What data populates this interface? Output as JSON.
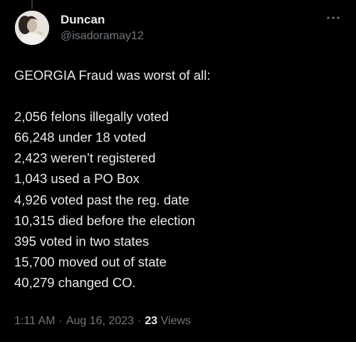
{
  "user": {
    "display_name": "Duncan",
    "handle": "@isadoramay12"
  },
  "tweet": {
    "text": "GEORGIA Fraud was worst of all:\n\n2,056 felons illegally voted\n66,248 under 18 voted\n2,423 weren’t registered\n1,043 used a PO Box\n4,926 voted past the reg. date\n10,315 died before the election\n395 voted in two states\n15,700 moved out of state\n40,279 changed CO."
  },
  "meta": {
    "time": "1:11 AM",
    "separator": "·",
    "date": "Aug 16, 2023",
    "views_count": "23",
    "views_label": "Views"
  },
  "icons": {
    "more": "more-options-icon"
  },
  "colors": {
    "background": "#000000",
    "primary_text": "#e7e9ea",
    "secondary_text": "#71767b"
  }
}
